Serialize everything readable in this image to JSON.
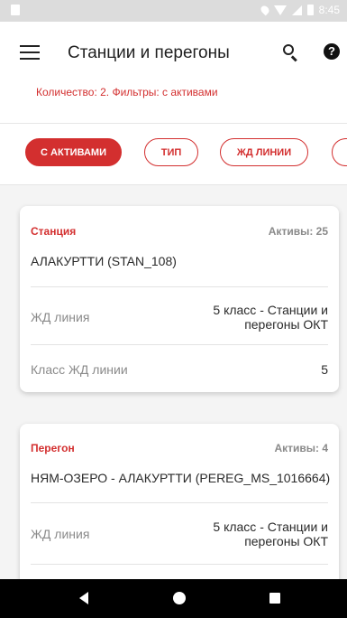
{
  "statusbar": {
    "time": "8:45"
  },
  "header": {
    "title": "Станции и перегоны",
    "summary": "Количество: 2. Фильтры: с активами"
  },
  "filters": [
    {
      "label": "С АКТИВАМИ",
      "active": true
    },
    {
      "label": "ТИП",
      "active": false
    },
    {
      "label": "ЖД ЛИНИИ",
      "active": false
    }
  ],
  "cards": [
    {
      "type": "Станция",
      "assets": "Активы: 25",
      "name": "АЛАКУРТТИ (STAN_108)",
      "rows": [
        {
          "label": "ЖД линия",
          "value_line1": "5 класс - Станции и",
          "value_line2": "перегоны ОКТ"
        },
        {
          "label": "Класс ЖД линии",
          "value": "5"
        }
      ]
    },
    {
      "type": "Перегон",
      "assets": "Активы: 4",
      "name": "НЯМ-ОЗЕРО - АЛАКУРТТИ (PEREG_MS_1016664)",
      "rows": [
        {
          "label": "ЖД линия",
          "value_line1": "5 класс - Станции и",
          "value_line2": "перегоны ОКТ"
        }
      ]
    }
  ],
  "colors": {
    "accent": "#d32f2f",
    "background": "#f4f4f4"
  }
}
